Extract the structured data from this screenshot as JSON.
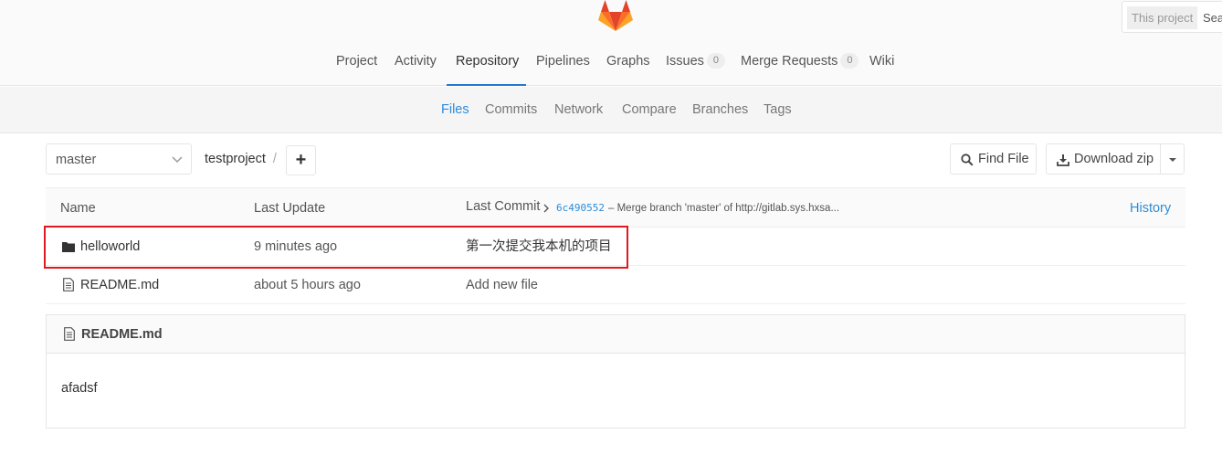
{
  "header": {
    "search": {
      "scope": "This project",
      "placeholder": "Sea"
    },
    "nav": [
      {
        "label": "Project"
      },
      {
        "label": "Activity"
      },
      {
        "label": "Repository",
        "active": true
      },
      {
        "label": "Pipelines"
      },
      {
        "label": "Graphs"
      },
      {
        "label": "Issues",
        "badge": "0"
      },
      {
        "label": "Merge Requests",
        "badge": "0"
      },
      {
        "label": "Wiki"
      }
    ]
  },
  "subnav": [
    {
      "label": "Files",
      "active": true
    },
    {
      "label": "Commits"
    },
    {
      "label": "Network"
    },
    {
      "label": "Compare"
    },
    {
      "label": "Branches"
    },
    {
      "label": "Tags"
    }
  ],
  "toolbar": {
    "branch": "master",
    "breadcrumb": "testproject",
    "breadcrumb_sep": "/",
    "add_label": "+",
    "find_file_label": "Find File",
    "download_label": "Download zip"
  },
  "tree": {
    "headers": {
      "name": "Name",
      "last_update": "Last Update",
      "last_commit": "Last Commit",
      "history": "History"
    },
    "last_commit": {
      "hash": "6c490552",
      "message": "– Merge branch 'master' of http://gitlab.sys.hxsa..."
    },
    "rows": [
      {
        "name": "helloworld",
        "type": "folder",
        "updated": "9 minutes ago",
        "message": "第一次提交我本机的项目"
      },
      {
        "name": "README.md",
        "type": "file",
        "updated": "about 5 hours ago",
        "message": "Add new file"
      }
    ]
  },
  "readme": {
    "title": "README.md",
    "content": "afadsf"
  },
  "colors": {
    "accent": "#1f78d1",
    "link": "#2e8cd9",
    "highlight": "#e0191f"
  }
}
